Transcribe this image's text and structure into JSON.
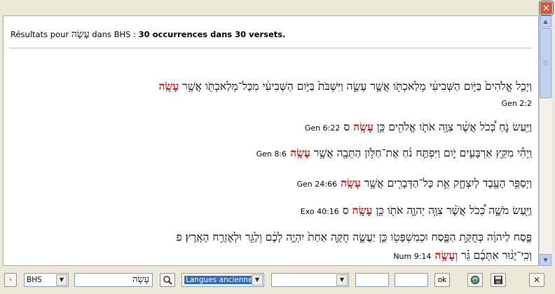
{
  "window": {
    "close_label": "✕"
  },
  "header": {
    "prefix": "Résultats pour ",
    "term": "עָשָׂה",
    "middle": " dans BHS : ",
    "summary": "30 occurrences dans 30 versets."
  },
  "verses": [
    {
      "ref": "Gen 2:2",
      "pre": "וַיְכַ֤ל אֱלֹהִים֙ בַּיֹּ֣ום הַשְּׁבִיעִ֔י מְלַאכְתֹּ֖ו אֲשֶׁ֣ר עָשָׂ֑ה וַיִּשְׁבֹּת֙ בַּיֹּ֣ום הַשְּׁבִיעִ֔י מִכָּל־מְלַאכְתֹּ֖ו אֲשֶׁ֥ר ",
      "hit": "עָשָֽׂה",
      "post": ""
    },
    {
      "ref": "Gen 6:22",
      "pre": "וַיַּ֖עַשׂ נֹ֑חַ כְּ֠כֹל אֲשֶׁ֨ר צִוָּ֥ה אֹתֹ֛ו אֱלֹהִ֖ים כֵּ֥ן ",
      "hit": "עָשָֽׂה",
      "post": " ס"
    },
    {
      "ref": "Gen 8:6",
      "pre": "וַֽיְהִ֕י מִקֵּ֖ץ אַרְבָּעִ֣ים יֹ֑ום וַיִּפְתַּ֣ח נֹ֔חַ אֶת־חַלֹּ֥ון הַתֵּבָ֖ה אֲשֶׁ֥ר ",
      "hit": "עָשָֽׂה",
      "post": ""
    },
    {
      "ref": "Gen 24:66",
      "pre": "וַיְסַפֵּ֥ר הָעֶ֖בֶד לְיִצְחָ֑ק אֵ֥ת כָּל־הַדְּבָרִ֖ים אֲשֶׁ֥ר ",
      "hit": "עָשָֽׂה",
      "post": ""
    },
    {
      "ref": "Exo 40:16",
      "pre": "וַיַּ֖עַשׂ מֹשֶׁ֑ה כְּ֠כֹל אֲשֶׁ֨ר צִוָּ֧ה יְהוָ֛ה אֹתֹ֖ו כֵּ֥ן ",
      "hit": "עָשָֽׂה",
      "post": " ס"
    },
    {
      "ref": "Num 9:14",
      "line1": "פֶּ֣סַח לַיהוָ֔ה כְּחֻקַּ֥ת הַפֶּ֛סַח וּכְמִשְׁפָּטֹ֖ו כֵּ֣ן יַעֲשֶׂ֑ה חֻקָּ֤ה אַחַת֙ יִהְיֶ֣ה לָכֶ֔ם וְלַגֵּ֖ר וּלְאֶזְרַ֥ח הָאָֽרֶץ׃ פ",
      "pre": "וְכִֽי־יָג֨וּר אִתְּכֶ֜ם גֵּ֗ר ",
      "hit": "וְעָשָׂ֥ה",
      "post": ""
    }
  ],
  "toolbar": {
    "back_label": "‹",
    "corpus": "BHS",
    "search_value": "עָשָׂה",
    "search_icon": "magnifier-icon",
    "language": "Langues anciennes",
    "filter1": "",
    "filter2": "",
    "field1": "",
    "field2": "",
    "ok_label": "ok",
    "close_label": "✕"
  }
}
